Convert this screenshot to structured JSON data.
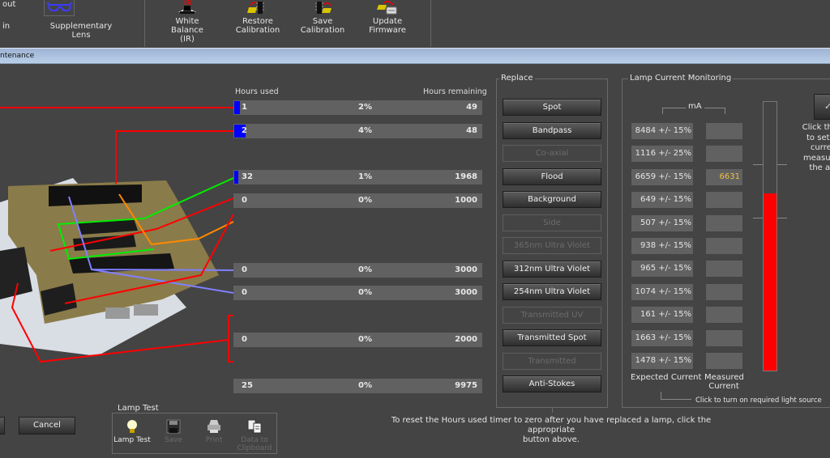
{
  "ribbon": {
    "small_items": [
      "out",
      "in"
    ],
    "buttons": [
      {
        "label": "Supplementary Lens",
        "icon": "glasses-icon"
      },
      {
        "label": "White Balance (IR)",
        "line1": "White Balance",
        "line2": "(IR)",
        "icon": "ir-camera-icon"
      },
      {
        "label": "Restore Calibration",
        "line1": "Restore",
        "line2": "Calibration",
        "icon": "restore-chip-icon"
      },
      {
        "label": "Save Calibration",
        "line1": "Save",
        "line2": "Calibration",
        "icon": "save-chip-icon"
      },
      {
        "label": "Update Firmware",
        "line1": "Update",
        "line2": "Firmware",
        "icon": "firmware-update-icon"
      }
    ]
  },
  "window": {
    "title": "ntenance"
  },
  "hours": {
    "used_header": "Hours used",
    "remaining_header": "Hours remaining",
    "rows": [
      {
        "used": "1",
        "percent": "2%",
        "remaining": "49",
        "fraction": 0.02
      },
      {
        "used": "2",
        "percent": "4%",
        "remaining": "48",
        "fraction": 0.04
      },
      {
        "used": "32",
        "percent": "1%",
        "remaining": "1968",
        "fraction": 0.01
      },
      {
        "used": "0",
        "percent": "0%",
        "remaining": "1000",
        "fraction": 0
      },
      {
        "used": "0",
        "percent": "0%",
        "remaining": "3000",
        "fraction": 0
      },
      {
        "used": "0",
        "percent": "0%",
        "remaining": "3000",
        "fraction": 0
      },
      {
        "used": "0",
        "percent": "0%",
        "remaining": "2000",
        "fraction": 0
      },
      {
        "used": "25",
        "percent": "0%",
        "remaining": "9975",
        "fraction": 0
      }
    ]
  },
  "replace": {
    "title": "Replace",
    "buttons": [
      {
        "label": "Spot",
        "enabled": true
      },
      {
        "label": "Bandpass",
        "enabled": true
      },
      {
        "label": "Co-axial",
        "enabled": false
      },
      {
        "label": "Flood",
        "enabled": true
      },
      {
        "label": "Background",
        "enabled": true
      },
      {
        "label": "Side",
        "enabled": false
      },
      {
        "label": "365nm Ultra Violet",
        "enabled": false
      },
      {
        "label": "312nm Ultra Violet",
        "enabled": true
      },
      {
        "label": "254nm Ultra Violet",
        "enabled": true
      },
      {
        "label": "Transmitted UV",
        "enabled": false
      },
      {
        "label": "Transmitted Spot",
        "enabled": true
      },
      {
        "label": "Transmitted",
        "enabled": false
      },
      {
        "label": "Anti-Stokes",
        "enabled": true
      }
    ]
  },
  "lamp_current": {
    "title": "Lamp Current Monitoring",
    "unit": "mA",
    "expected_header": "Expected Current",
    "measured_header_1": "Measured",
    "measured_header_2": "Current",
    "hint": "Click to turn on required light source",
    "meter_fraction": 0.66,
    "side_text": [
      "Click the a",
      "to set th",
      "curren",
      "measured",
      "the act"
    ],
    "rows": [
      {
        "expected": "8484 +/- 15%",
        "measured": ""
      },
      {
        "expected": "1116 +/- 25%",
        "measured": ""
      },
      {
        "expected": "6659 +/- 15%",
        "measured": "6631"
      },
      {
        "expected": "649 +/- 15%",
        "measured": ""
      },
      {
        "expected": "507 +/- 15%",
        "measured": ""
      },
      {
        "expected": "938 +/- 15%",
        "measured": ""
      },
      {
        "expected": "965 +/- 15%",
        "measured": ""
      },
      {
        "expected": "1074 +/- 15%",
        "measured": ""
      },
      {
        "expected": "161 +/- 15%",
        "measured": ""
      },
      {
        "expected": "1663 +/- 15%",
        "measured": ""
      },
      {
        "expected": "1478 +/- 15%",
        "measured": ""
      }
    ]
  },
  "footer": {
    "cancel_label": "Cancel",
    "note_line1": "To reset the Hours used timer to zero after you have replaced a lamp, click the appropriate",
    "note_line2": "button above.",
    "lamp_test": {
      "title": "Lamp Test",
      "items": [
        {
          "label": "Lamp Test",
          "enabled": true
        },
        {
          "label": "Save",
          "enabled": false
        },
        {
          "label": "Print",
          "enabled": false
        },
        {
          "label": "Data to",
          "label2": "Clipboard",
          "enabled": false
        }
      ]
    }
  },
  "colors": {
    "accent_blue": "#0000ff",
    "meter_red": "#ff0000",
    "measured_value": "#f0c040"
  }
}
